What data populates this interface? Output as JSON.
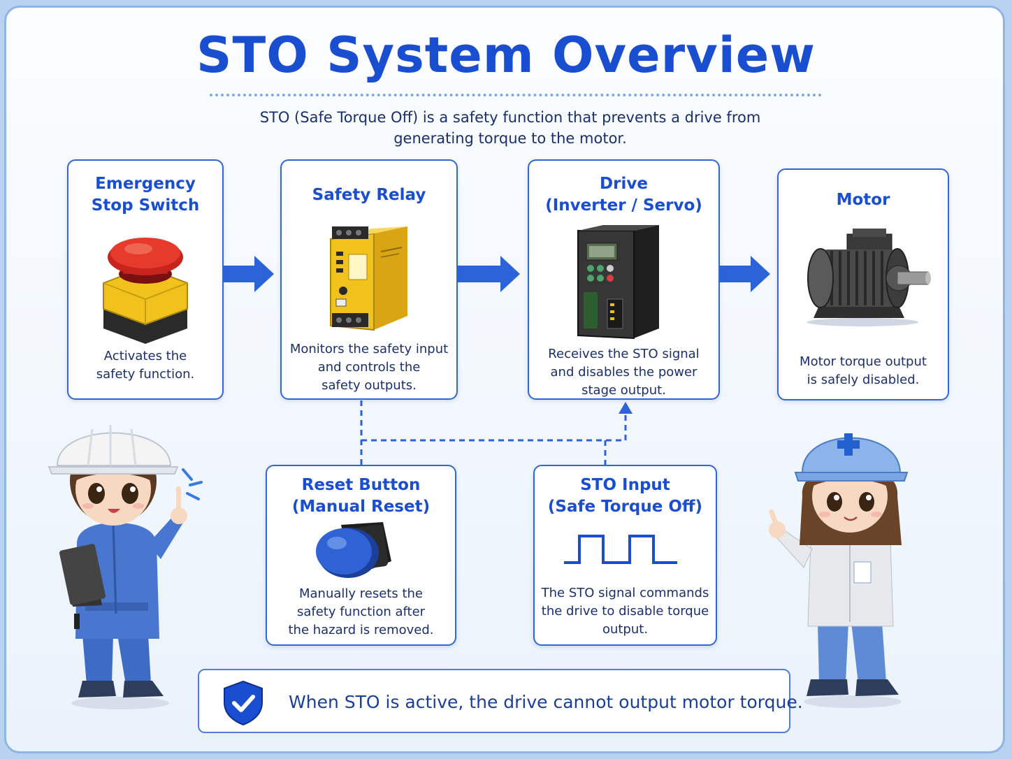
{
  "title": "STO System Overview",
  "subtitle": "STO (Safe Torque Off) is a safety function that prevents a drive from\ngenerating torque to the motor.",
  "colors": {
    "accent": "#1a4ed1",
    "card_border": "#2f68d6",
    "text": "#1b2f6b",
    "arrow": "#2d63d8"
  },
  "flow": [
    {
      "title": "Emergency\nStop Switch",
      "description": "Activates the\nsafety function.",
      "icon": "emergency-stop-icon"
    },
    {
      "title": "Safety Relay",
      "description": "Monitors the safety input\nand controls the\nsafety outputs.",
      "icon": "safety-relay-icon"
    },
    {
      "title": "Drive\n(Inverter / Servo)",
      "description": "Receives the STO signal\nand disables the power\nstage output.",
      "icon": "drive-icon"
    },
    {
      "title": "Motor",
      "description": "Motor torque output\nis safely disabled.",
      "icon": "motor-icon"
    }
  ],
  "inputs": [
    {
      "title": "Reset Button\n(Manual Reset)",
      "description": "Manually resets the\nsafety function after\nthe hazard is removed.",
      "icon": "reset-button-icon"
    },
    {
      "title": "STO Input\n(Safe Torque Off)",
      "description": "The STO signal commands\nthe drive to disable torque\noutput.",
      "icon": "sto-signal-icon"
    }
  ],
  "note": {
    "text": "When STO is active, the drive cannot output motor torque.",
    "icon": "shield-check-icon"
  }
}
